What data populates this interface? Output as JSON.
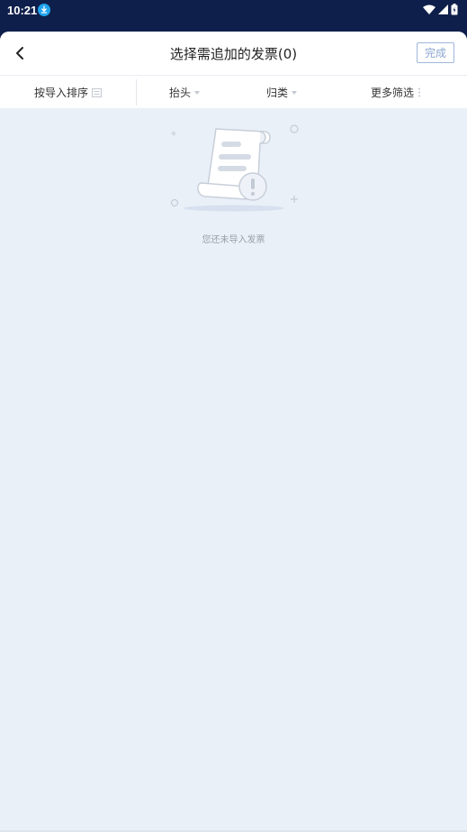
{
  "status_bar": {
    "time": "10:21",
    "icons": [
      "download-icon",
      "wifi-icon",
      "signal-icon",
      "battery-icon"
    ]
  },
  "header": {
    "title": "选择需追加的发票(0)",
    "done_label": "完成"
  },
  "filters": {
    "sort_label": "按导入排序",
    "header_label": "抬头",
    "category_label": "归类",
    "more_label": "更多筛选"
  },
  "empty_state": {
    "message": "您还未导入发票"
  },
  "colors": {
    "status_bar": "#0f1f4b",
    "background": "#eaf0f8",
    "accent": "#8aa5d0",
    "download_badge": "#1fa3ee"
  }
}
